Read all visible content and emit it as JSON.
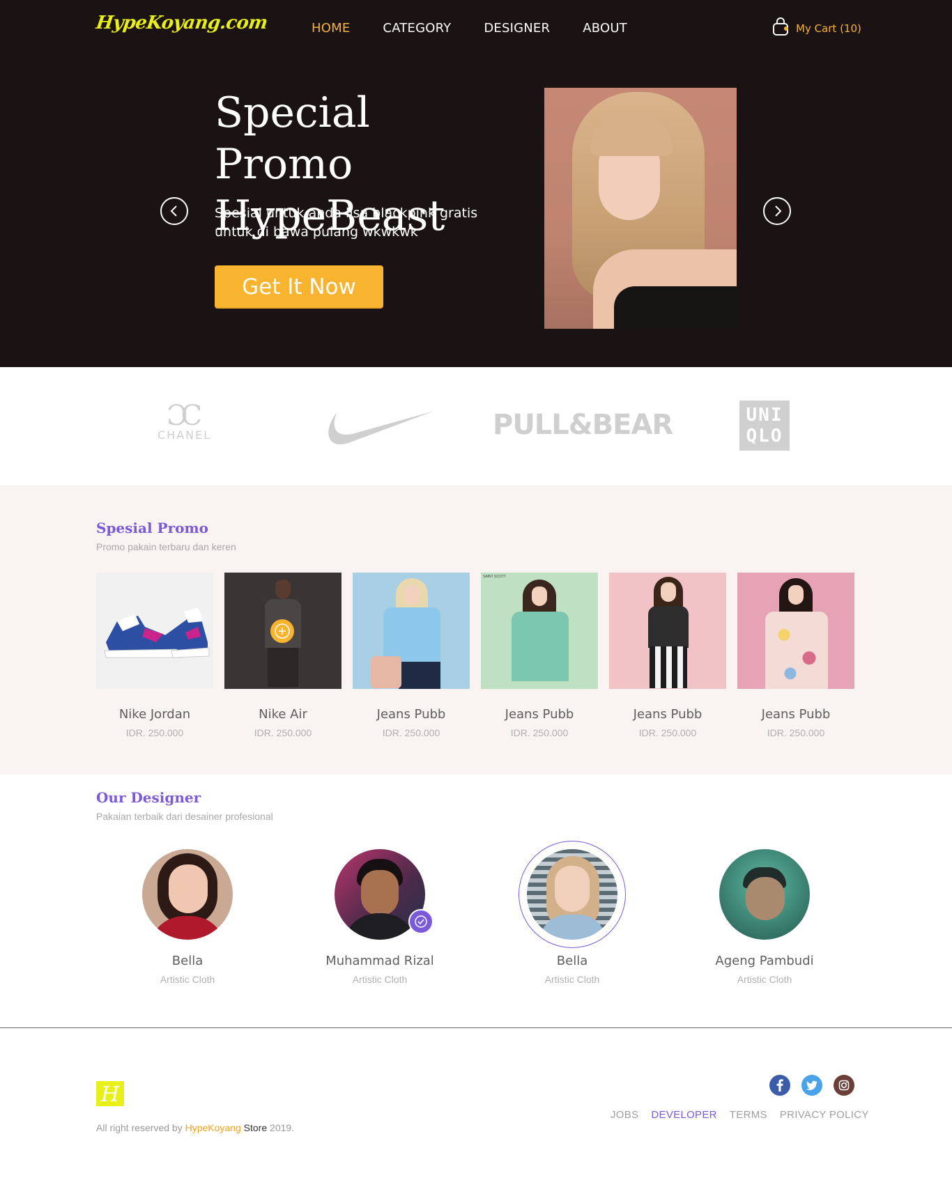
{
  "header": {
    "logo": "HypeKoyang.com",
    "nav": [
      {
        "label": "HOME",
        "active": true
      },
      {
        "label": "CATEGORY",
        "active": false
      },
      {
        "label": "DESIGNER",
        "active": false
      },
      {
        "label": "ABOUT",
        "active": false
      }
    ],
    "cart_label": "My Cart (10)",
    "accent_color": "#f4b237"
  },
  "hero": {
    "title_line1": "Special Promo",
    "title_line2": "HypeBeast",
    "description": "Spesial untuk anda lisa blackpink gratis untuk di bawa pulang wkwkwk",
    "button_label": "Get It Now",
    "button_color": "#f8b32f",
    "prev_icon": "chevron-left-circle-icon",
    "next_icon": "chevron-right-circle-icon"
  },
  "brands": [
    {
      "name": "CHANEL",
      "icon": "chanel-logo"
    },
    {
      "name": "nike",
      "icon": "nike-swoosh-logo"
    },
    {
      "name": "PULL&BEAR",
      "icon": "pull-and-bear-logo"
    },
    {
      "name": "UNIQLO",
      "icon": "uniqlo-logo",
      "line1": "UNI",
      "line2": "QLO"
    }
  ],
  "promo": {
    "title": "Spesial Promo",
    "subtitle": "Promo pakain terbaru dan keren",
    "products": [
      {
        "name": "Nike Jordan",
        "price": "IDR. 250.000"
      },
      {
        "name": "Nike Air",
        "price": "IDR. 250.000"
      },
      {
        "name": "Jeans Pubb",
        "price": "IDR. 250.000"
      },
      {
        "name": "Jeans Pubb",
        "price": "IDR. 250.000"
      },
      {
        "name": "Jeans Pubb",
        "price": "IDR. 250.000"
      },
      {
        "name": "Jeans Pubb",
        "price": "IDR. 250.000"
      }
    ],
    "product4_tag": "SAINT SCOTT"
  },
  "designers": {
    "title": "Our Designer",
    "subtitle": "Pakaian terbaik dari desainer profesional",
    "items": [
      {
        "name": "Bella",
        "role": "Artistic Cloth"
      },
      {
        "name": "Muhammad Rizal",
        "role": "Artistic Cloth",
        "verified": true
      },
      {
        "name": "Bella",
        "role": "Artistic Cloth",
        "selected": true
      },
      {
        "name": "Ageng Pambudi",
        "role": "Artistic Cloth"
      }
    ]
  },
  "footer": {
    "logo_mark": "H",
    "copyright_prefix": "All right reserved by ",
    "copyright_brand": "HypeKoyang",
    "copyright_store": " Store",
    "copyright_year": " 2019.",
    "links": [
      {
        "label": "JOBS",
        "active": false
      },
      {
        "label": "DEVELOPER",
        "active": true
      },
      {
        "label": "TERMS",
        "active": false
      },
      {
        "label": "PRIVACY POLICY",
        "active": false
      }
    ],
    "socials": [
      "facebook-icon",
      "twitter-icon",
      "instagram-icon"
    ],
    "link_accent": "#7a5ad8"
  }
}
